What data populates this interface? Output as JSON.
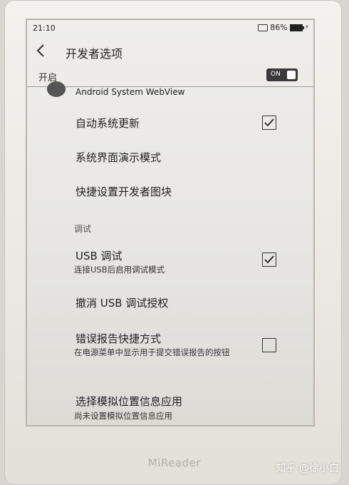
{
  "status": {
    "time": "21:10",
    "battery": "86%"
  },
  "header": {
    "title": "开发者选项"
  },
  "master": {
    "label": "开启",
    "toggle_text": "ON"
  },
  "items": {
    "webview": {
      "title": "Android System WebView"
    },
    "auto_update": {
      "title": "自动系统更新",
      "checked": true
    },
    "demo_mode": {
      "title": "系统界面演示模式"
    },
    "quick_tiles": {
      "title": "快捷设置开发者图块"
    },
    "section_debug": {
      "label": "调试"
    },
    "usb_debug": {
      "title": "USB 调试",
      "summary": "连接USB后启用调试模式",
      "checked": true
    },
    "revoke_usb": {
      "title": "撤消 USB 调试授权"
    },
    "bug_report": {
      "title": "错误报告快捷方式",
      "summary": "在电源菜单中显示用于提交错误报告的按钮",
      "checked": false
    },
    "mock_location": {
      "title": "选择模拟位置信息应用",
      "summary": "尚未设置模拟位置信息应用"
    }
  },
  "device": {
    "brand": "MiReader"
  },
  "watermark": "知乎 @徐小白"
}
